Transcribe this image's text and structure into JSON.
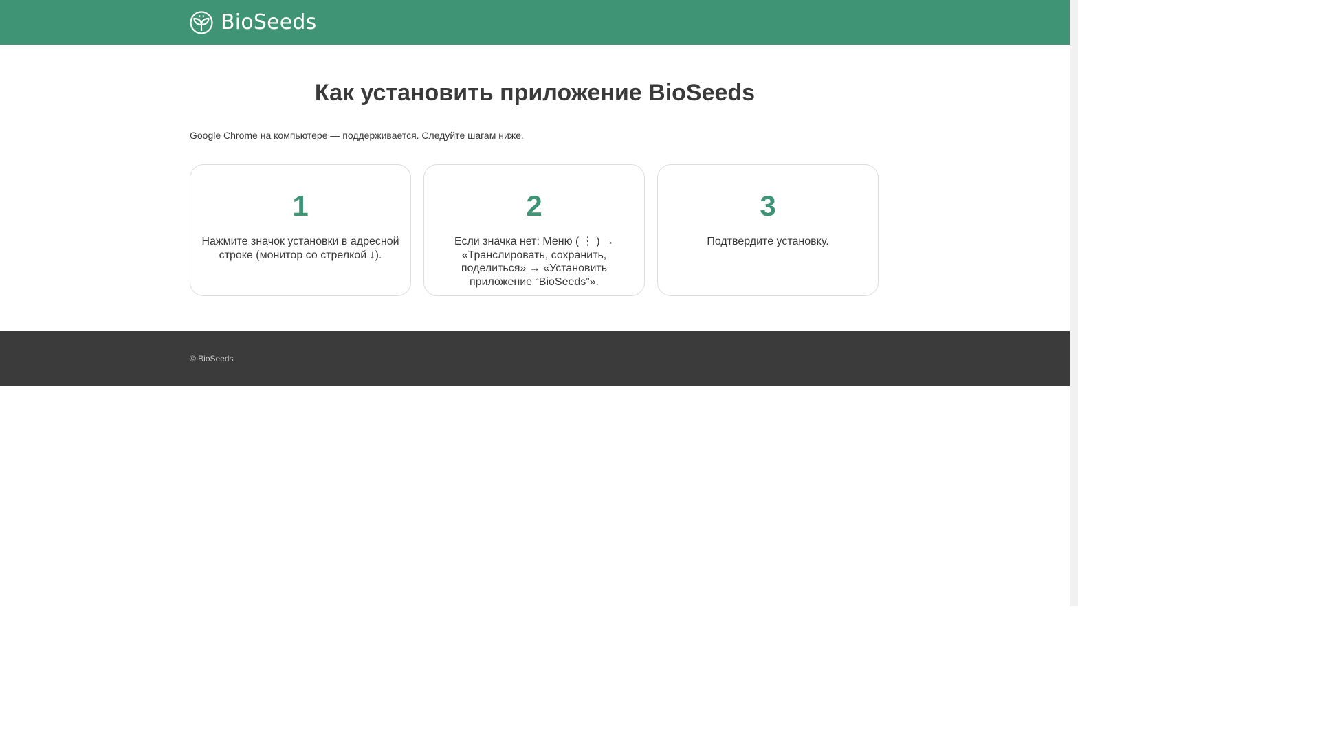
{
  "header": {
    "logo_text": "BioSeeds",
    "logo_icon": "sprout-circle-icon",
    "background_color": "#3e9474"
  },
  "main": {
    "title": "Как установить приложение BioSeeds",
    "intro": "Google Chrome на компьютере — поддерживается. Следуйте шагам ниже.",
    "steps": [
      {
        "number": "1",
        "text": "Нажмите значок установки в адресной строке (монитор со стрелкой ↓)."
      },
      {
        "number": "2",
        "text": "Если значка нет: Меню ( ⋮ ) → «Транслировать, сохранить, поделиться» → «Установить приложение “BioSeeds”»."
      },
      {
        "number": "3",
        "text": "Подтвердите установку."
      }
    ],
    "accent_color": "#3e9474"
  },
  "footer": {
    "copyright": "© BioSeeds",
    "background_color": "#3b3b3b"
  }
}
